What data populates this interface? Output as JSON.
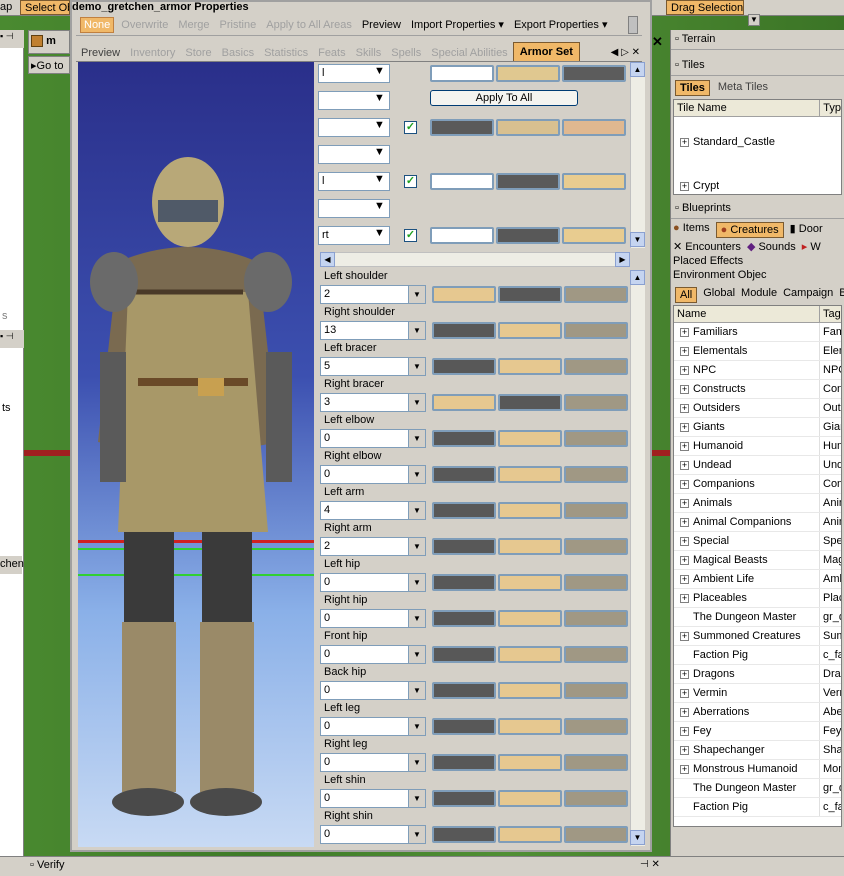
{
  "top": {
    "left_label": "ap",
    "select_btn": "Select Ob",
    "drag_btn": "Drag Selection"
  },
  "left": {
    "tab_label": "m",
    "goto_label": "Go to",
    "lower_labels": [
      "s",
      "ts",
      "chen"
    ]
  },
  "window": {
    "title": "demo_gretchen_armor Properties",
    "toolbar": [
      "None",
      "Overwrite",
      "Merge",
      "Pristine",
      "Apply to All Areas",
      "Preview",
      "Import Properties",
      "Export Properties"
    ],
    "tabs": [
      "Preview",
      "Inventory",
      "Store",
      "Basics",
      "Statistics",
      "Feats",
      "Skills",
      "Spells",
      "Special Abilities",
      "Armor Set"
    ],
    "apply_all": "Apply To All",
    "top_rows": [
      {
        "value": "l",
        "checked": null,
        "colors": [
          "#ffffff",
          "#e0c890",
          "#5c5c5c"
        ]
      },
      {
        "value": "",
        "checked": null,
        "colors": []
      },
      {
        "value": "",
        "checked": true,
        "colors": [
          "#5a5a5a",
          "#d8c090",
          "#e0b890"
        ]
      },
      {
        "value": "",
        "checked": null,
        "colors": []
      },
      {
        "value": "l",
        "checked": true,
        "colors": [
          "#ffffff",
          "#5a5a5a",
          "#e8cc90"
        ]
      },
      {
        "value": "",
        "checked": null,
        "colors": []
      },
      {
        "value": "rt",
        "checked": true,
        "colors": [
          "#ffffff",
          "#585858",
          "#e8cc90"
        ]
      }
    ],
    "parts": [
      {
        "label": "Left shoulder",
        "value": "2",
        "colors": [
          "#e6c890",
          "#585858",
          "#a09884"
        ]
      },
      {
        "label": "Right shoulder",
        "value": "13",
        "colors": [
          "#585858",
          "#e6c890",
          "#a09884"
        ]
      },
      {
        "label": "Left bracer",
        "value": "5",
        "colors": [
          "#585858",
          "#e6c890",
          "#a09884"
        ]
      },
      {
        "label": "Right bracer",
        "value": "3",
        "colors": [
          "#e6c890",
          "#585858",
          "#a09884"
        ]
      },
      {
        "label": "Left elbow",
        "value": "0",
        "colors": [
          "#585858",
          "#e6c890",
          "#a09884"
        ]
      },
      {
        "label": "Right elbow",
        "value": "0",
        "colors": [
          "#585858",
          "#e6c890",
          "#a09884"
        ]
      },
      {
        "label": "Left arm",
        "value": "4",
        "colors": [
          "#585858",
          "#e6c890",
          "#a09884"
        ]
      },
      {
        "label": "Right arm",
        "value": "2",
        "colors": [
          "#585858",
          "#e6c890",
          "#a09884"
        ]
      },
      {
        "label": "Left hip",
        "value": "0",
        "colors": [
          "#585858",
          "#e6c890",
          "#a09884"
        ]
      },
      {
        "label": "Right hip",
        "value": "0",
        "colors": [
          "#585858",
          "#e6c890",
          "#a09884"
        ]
      },
      {
        "label": "Front hip",
        "value": "0",
        "colors": [
          "#585858",
          "#e6c890",
          "#a09884"
        ]
      },
      {
        "label": "Back hip",
        "value": "0",
        "colors": [
          "#585858",
          "#e6c890",
          "#a09884"
        ]
      },
      {
        "label": "Left leg",
        "value": "0",
        "colors": [
          "#585858",
          "#e6c890",
          "#a09884"
        ]
      },
      {
        "label": "Right leg",
        "value": "0",
        "colors": [
          "#585858",
          "#e6c890",
          "#a09884"
        ]
      },
      {
        "label": "Left shin",
        "value": "0",
        "colors": [
          "#585858",
          "#e6c890",
          "#a09884"
        ]
      },
      {
        "label": "Right shin",
        "value": "0",
        "colors": [
          "#585858",
          "#e6c890",
          "#a09884"
        ]
      }
    ]
  },
  "right": {
    "terrain": "Terrain",
    "tiles": "Tiles",
    "tiles_tabs": [
      "Tiles",
      "Meta Tiles"
    ],
    "tile_cols": [
      "Tile Name",
      "Typ"
    ],
    "tile_rows": [
      "Standard_Castle",
      "Crypt"
    ],
    "blueprints": "Blueprints",
    "bp_tabs": [
      "Items",
      "Creatures",
      "Door",
      "Encounters",
      "Sounds",
      "W",
      "Placed Effects",
      "Environment Objec"
    ],
    "scope_tabs": [
      "All",
      "Global",
      "Module",
      "Campaign",
      "B"
    ],
    "list_cols": [
      "Name",
      "Tag"
    ],
    "rows": [
      {
        "name": "Familiars",
        "tag": "Fami",
        "plus": true
      },
      {
        "name": "Elementals",
        "tag": "Elem",
        "plus": true
      },
      {
        "name": "NPC",
        "tag": "NPC",
        "plus": true
      },
      {
        "name": "Constructs",
        "tag": "Cons",
        "plus": true
      },
      {
        "name": "Outsiders",
        "tag": "Outs",
        "plus": true
      },
      {
        "name": "Giants",
        "tag": "Giant",
        "plus": true
      },
      {
        "name": "Humanoid",
        "tag": "Hum",
        "plus": true
      },
      {
        "name": "Undead",
        "tag": "Unde",
        "plus": true
      },
      {
        "name": "Companions",
        "tag": "Comp",
        "plus": true
      },
      {
        "name": "Animals",
        "tag": "Anim",
        "plus": true
      },
      {
        "name": "Animal Companions",
        "tag": "Anim",
        "plus": true
      },
      {
        "name": "Special",
        "tag": "Spec",
        "plus": true
      },
      {
        "name": "Magical Beasts",
        "tag": "Magi",
        "plus": true
      },
      {
        "name": "Ambient Life",
        "tag": "Amb",
        "plus": true
      },
      {
        "name": "Placeables",
        "tag": "Place",
        "plus": true
      },
      {
        "name": "The Dungeon Master",
        "tag": "gr_d",
        "plus": false
      },
      {
        "name": "Summoned Creatures",
        "tag": "Sum",
        "plus": true
      },
      {
        "name": "Faction Pig",
        "tag": "c_fa",
        "plus": false
      },
      {
        "name": "Dragons",
        "tag": "Drag",
        "plus": true
      },
      {
        "name": "Vermin",
        "tag": "Verm",
        "plus": true
      },
      {
        "name": "Aberrations",
        "tag": "Aber",
        "plus": true
      },
      {
        "name": "Fey",
        "tag": "Fey",
        "plus": true
      },
      {
        "name": "Shapechanger",
        "tag": "Shap",
        "plus": true
      },
      {
        "name": "Monstrous Humanoid",
        "tag": "Mons",
        "plus": true
      },
      {
        "name": "The Dungeon Master",
        "tag": "gr_d",
        "plus": false
      },
      {
        "name": "Faction Pig",
        "tag": "c_fa",
        "plus": false
      }
    ],
    "verify": "Verify"
  }
}
